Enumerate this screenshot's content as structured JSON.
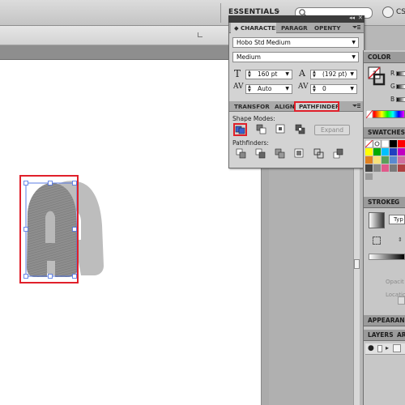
{
  "workspace": {
    "label": "ESSENTIALS",
    "arrow": "▾",
    "search_placeholder": "",
    "cs_label": "CS"
  },
  "character_panel": {
    "tabs": [
      "CHARACTER",
      "PARAGR",
      "OPENTY"
    ],
    "font_family": "Hobo Std Medium",
    "font_style": "Medium",
    "font_size": "160 pt",
    "leading": "(192 pt)",
    "kerning": "Auto",
    "tracking": "0"
  },
  "pathfinder_panel": {
    "tabs": [
      "TRANSFOR",
      "ALIGN",
      "PATHFINDER"
    ],
    "shape_modes_label": "Shape Modes:",
    "expand_label": "Expand",
    "pathfinders_label": "Pathfinders:"
  },
  "color_panel": {
    "title": "COLOR",
    "channels": [
      "R",
      "G",
      "B"
    ]
  },
  "swatches_panel": {
    "title": "SWATCHES"
  },
  "stroke_panel": {
    "title": "STROKE",
    "second_tab": "G",
    "type_label": "Typ",
    "opacity_label": "Opacit",
    "location_label": "Locatio"
  },
  "appearance_panel": {
    "title": "APPEARANC"
  },
  "layers_panel": {
    "title": "LAYERS",
    "second_tab": "AR"
  },
  "colors": {
    "highlight": "#e0202a",
    "selection": "#4a6fe3",
    "panel_bg": "#d3d3d3",
    "artwork_gray": "#9c9c9c"
  },
  "icons": [
    "search-icon",
    "panel-menu-icon",
    "font-size-icon",
    "leading-icon",
    "kerning-icon",
    "tracking-icon",
    "unite-icon",
    "minus-front-icon",
    "intersect-icon",
    "exclude-icon",
    "divide-icon",
    "trim-icon",
    "merge-icon",
    "crop-icon",
    "outline-icon",
    "minus-back-icon",
    "fill-stroke-icon",
    "gradient-swatch-icon"
  ]
}
